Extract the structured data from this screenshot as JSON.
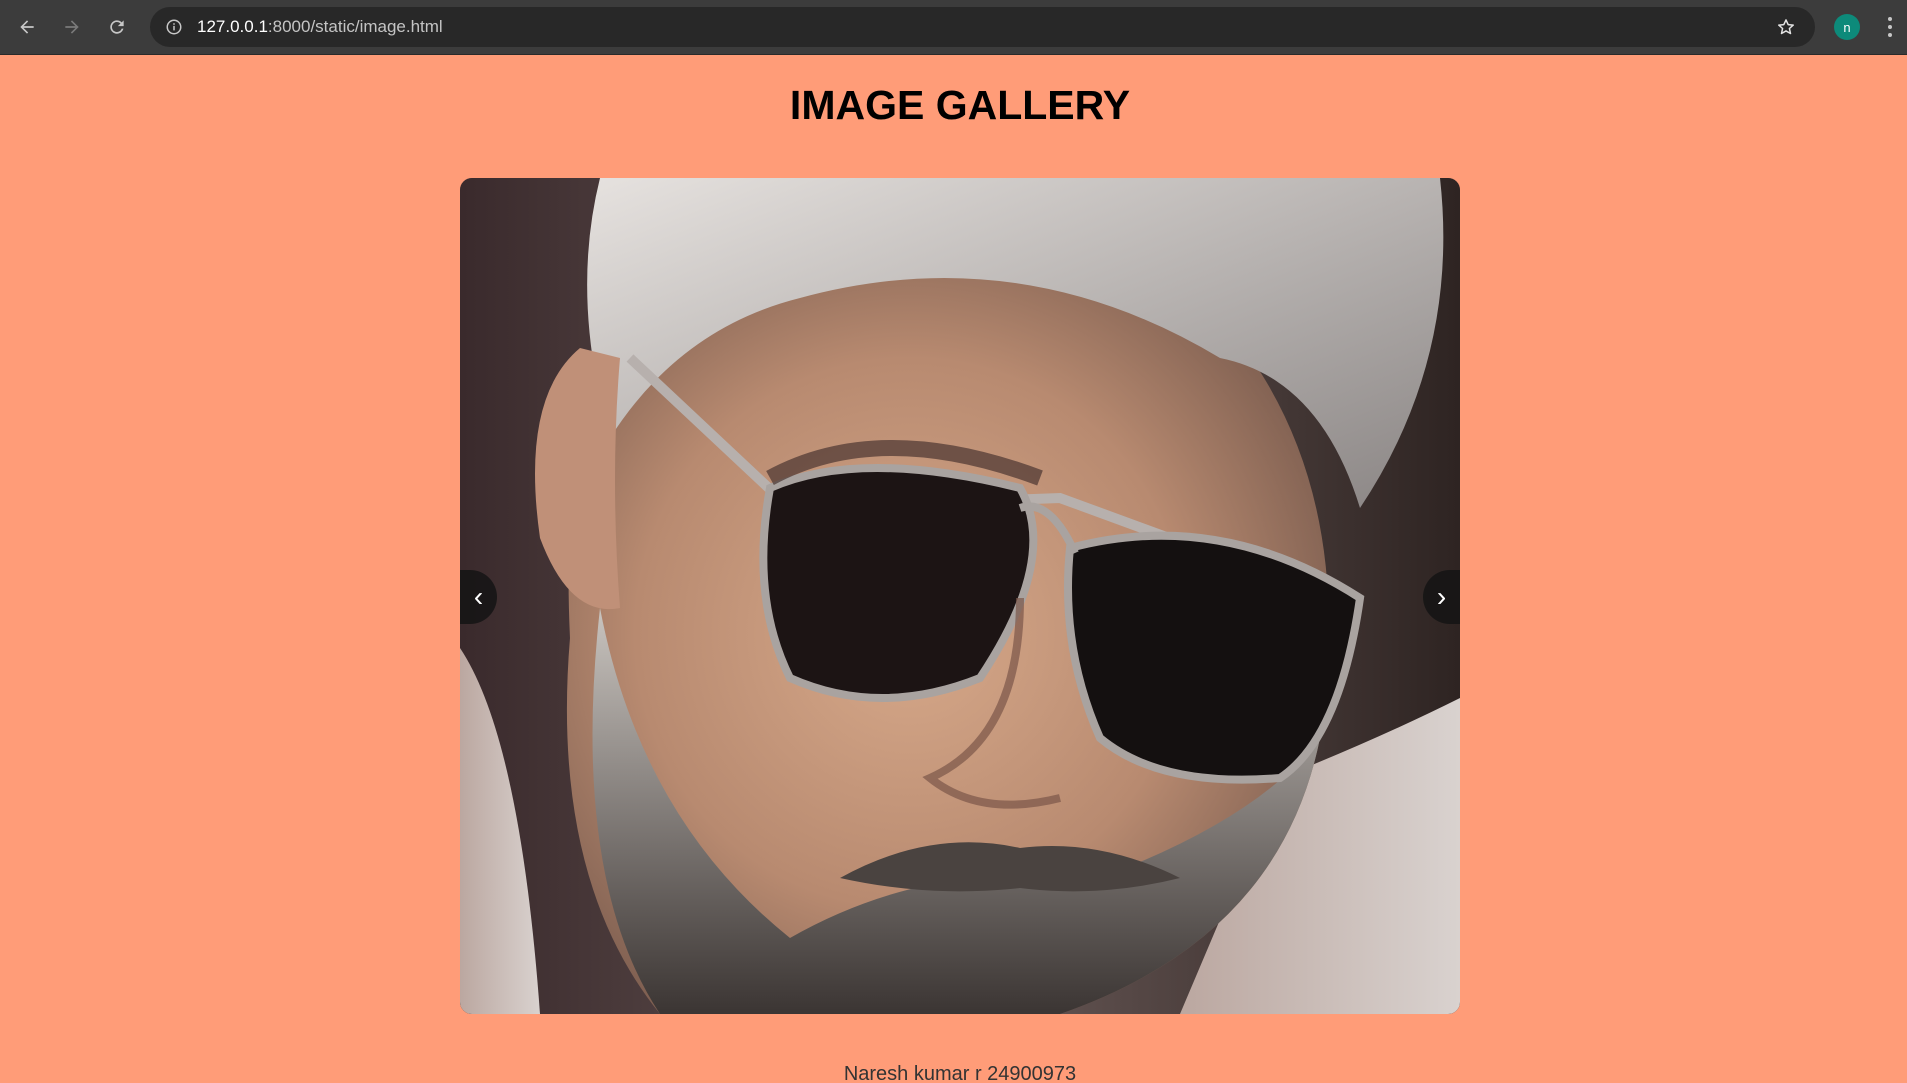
{
  "browser": {
    "url_host": "127.0.0.1",
    "url_path": ":8000/static/image.html",
    "profile_initial": "n",
    "icons": {
      "back": "back-arrow-icon",
      "forward": "forward-arrow-icon",
      "reload": "reload-icon",
      "site_info": "info-icon",
      "bookmark": "star-icon",
      "menu": "kebab-menu-icon"
    }
  },
  "page": {
    "title": "IMAGE GALLERY",
    "background": "#ff9c78"
  },
  "gallery": {
    "prev_label": "‹",
    "next_label": "›"
  },
  "footer": {
    "caption": "Naresh kumar r 24900973"
  }
}
